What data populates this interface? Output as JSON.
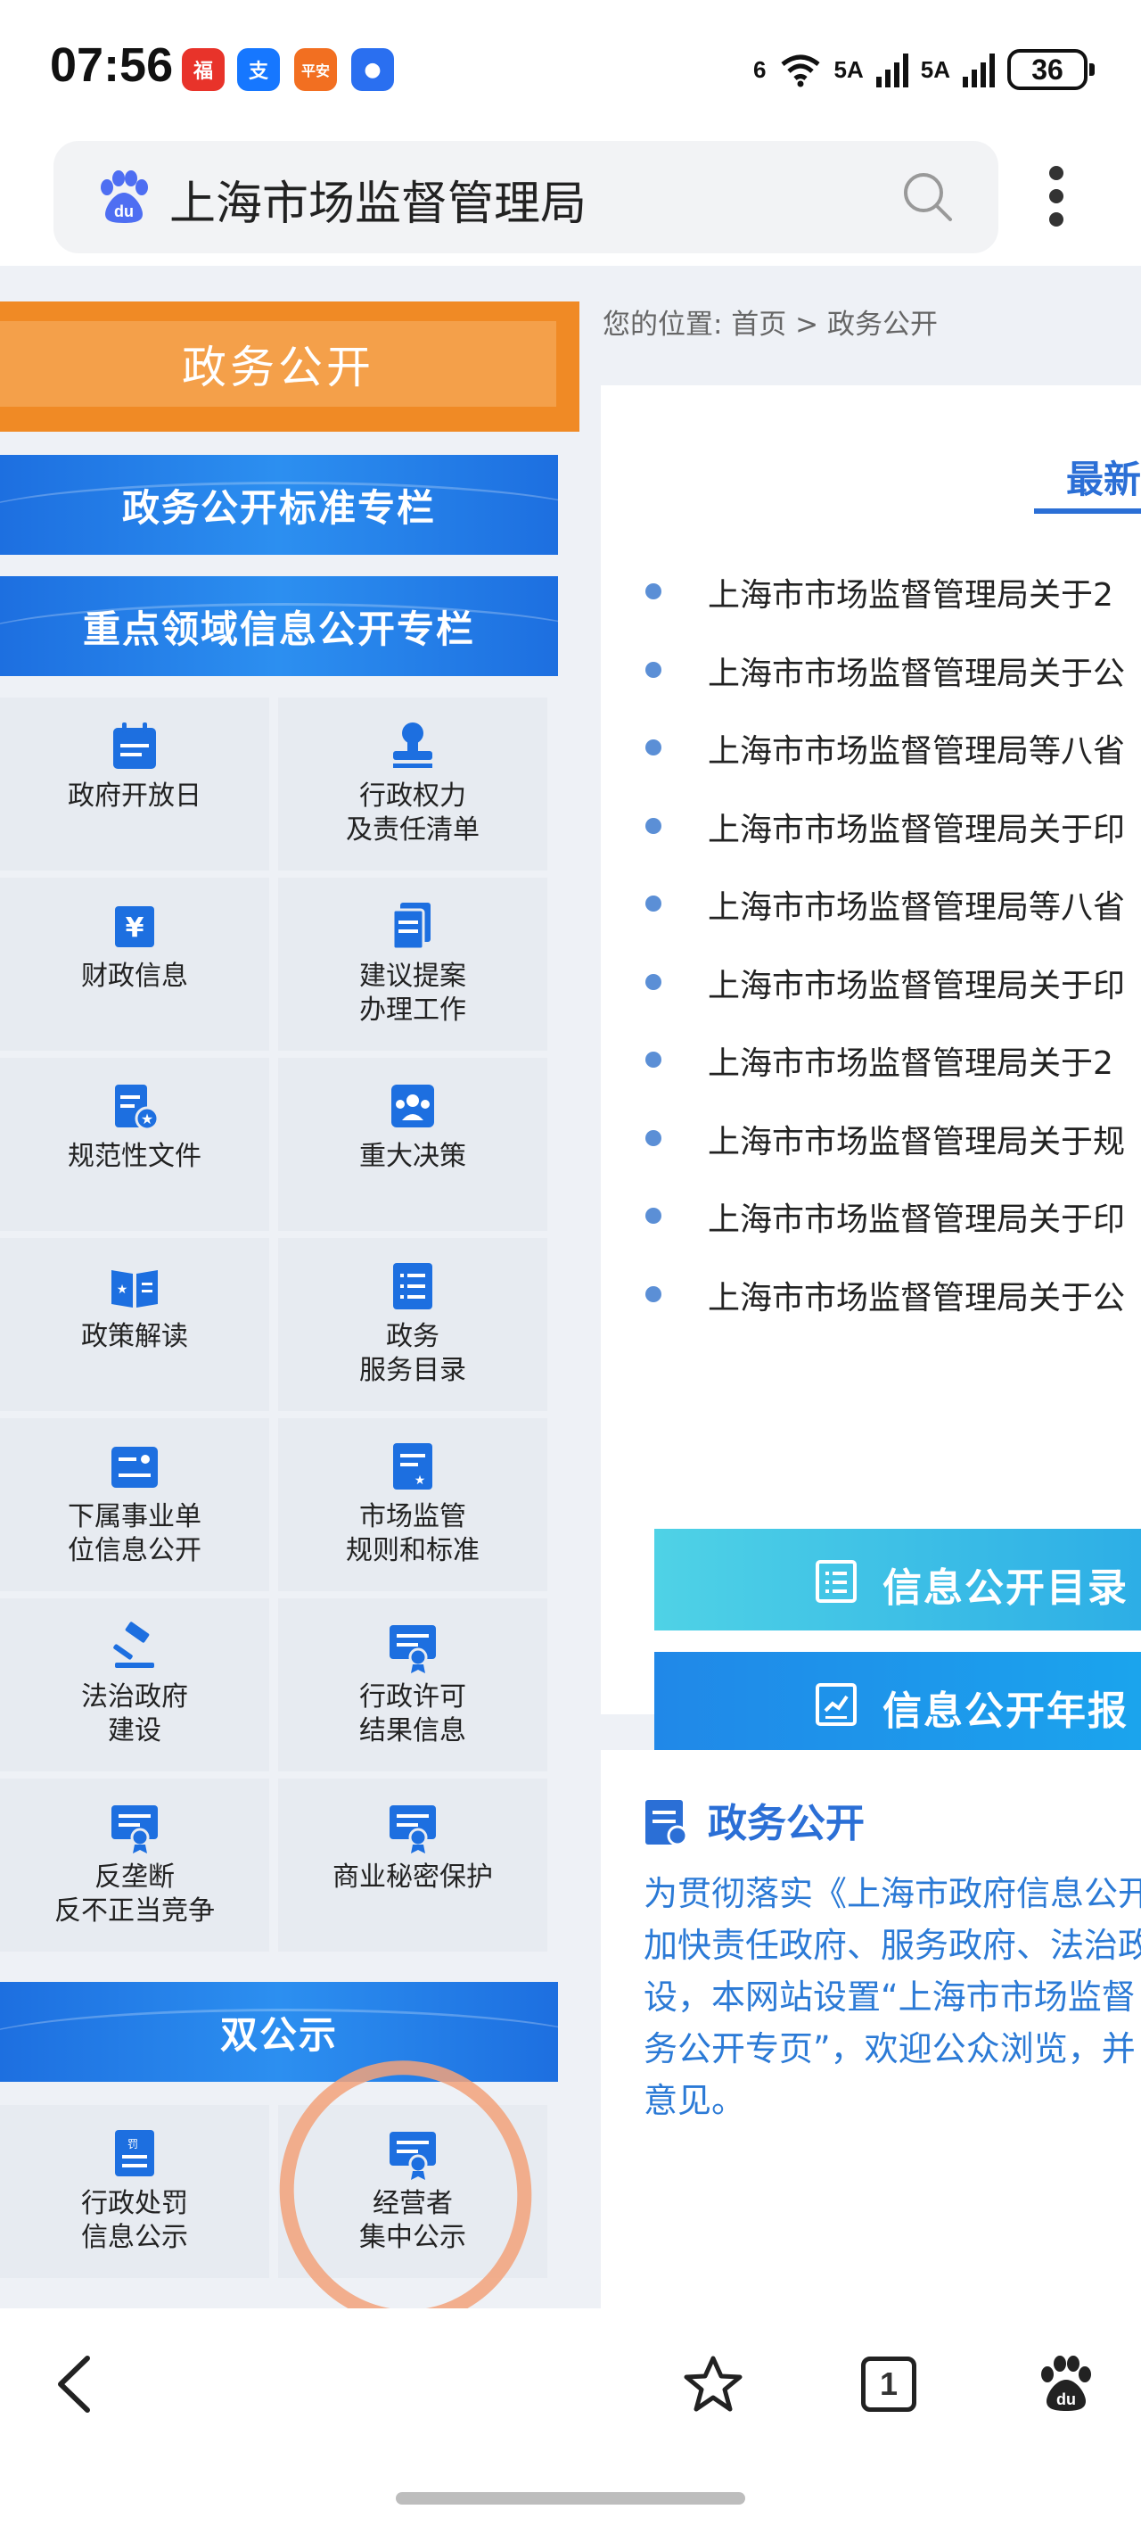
{
  "status_bar": {
    "time": "07:56",
    "app_icons": [
      {
        "name": "app-icon-red",
        "color": "#e8332a",
        "glyph": "福"
      },
      {
        "name": "alipay-icon",
        "color": "#1677ff",
        "glyph": "支"
      },
      {
        "name": "pingan-bank-icon",
        "color": "#f26f21",
        "glyph": "平安"
      },
      {
        "name": "shield-app-icon",
        "color": "#2a6ff0",
        "glyph": "●"
      }
    ],
    "wifi_label": "6",
    "signal1_label": "5A",
    "signal2_label": "5A",
    "battery": "36"
  },
  "search_bar": {
    "title": "上海市场监督管理局"
  },
  "left_nav": {
    "header": "政务公开",
    "banners": [
      "政务公开标准专栏",
      "重点领域信息公开专栏"
    ],
    "items": [
      {
        "label_line1": "政府开放日",
        "label_line2": "",
        "icon": "calendar-icon"
      },
      {
        "label_line1": "行政权力",
        "label_line2": "及责任清单",
        "icon": "stamp-icon"
      },
      {
        "label_line1": "财政信息",
        "label_line2": "",
        "icon": "yuan-icon"
      },
      {
        "label_line1": "建议提案",
        "label_line2": "办理工作",
        "icon": "document-stack-icon"
      },
      {
        "label_line1": "规范性文件",
        "label_line2": "",
        "icon": "document-star-icon"
      },
      {
        "label_line1": "重大决策",
        "label_line2": "",
        "icon": "gear-people-icon"
      },
      {
        "label_line1": "政策解读",
        "label_line2": "",
        "icon": "open-book-icon"
      },
      {
        "label_line1": "政务",
        "label_line2": "服务目录",
        "icon": "list-icon"
      },
      {
        "label_line1": "下属事业单",
        "label_line2": "位信息公开",
        "icon": "id-card-icon"
      },
      {
        "label_line1": "市场监管",
        "label_line2": "规则和标准",
        "icon": "rules-icon"
      },
      {
        "label_line1": "法治政府",
        "label_line2": "建设",
        "icon": "gavel-icon"
      },
      {
        "label_line1": "行政许可",
        "label_line2": "结果信息",
        "icon": "certificate-icon"
      },
      {
        "label_line1": "反垄断",
        "label_line2": "反不正当竞争",
        "icon": "certificate-icon"
      },
      {
        "label_line1": "商业秘密保护",
        "label_line2": "",
        "icon": "certificate-icon"
      }
    ],
    "double_banner": "双公示",
    "double_items": [
      {
        "label_line1": "行政处罚",
        "label_line2": "信息公示",
        "icon": "penalty-icon"
      },
      {
        "label_line1": "经营者",
        "label_line2": "集中公示",
        "icon": "certificate-icon"
      }
    ]
  },
  "breadcrumb": "您的位置: 首页 > 政务公开",
  "latest": {
    "tab_label": "最新",
    "news": [
      "上海市市场监督管理局关于2",
      "上海市市场监督管理局关于公",
      "上海市市场监督管理局等八省",
      "上海市市场监督管理局关于印",
      "上海市市场监督管理局等八省",
      "上海市市场监督管理局关于印",
      "上海市市场监督管理局关于2",
      "上海市市场监督管理局关于规",
      "上海市市场监督管理局关于印",
      "上海市市场监督管理局关于公"
    ]
  },
  "buttons": {
    "directory": "信息公开目录",
    "annual_report": "信息公开年报"
  },
  "intro": {
    "title": "政务公开",
    "lines": [
      "为贯彻落实《上海市政府信息公开",
      "加快责任政府、服务政府、法治政",
      "设，本网站设置“上海市市场监督",
      "务公开专页”，欢迎公众浏览，并",
      "意见。"
    ]
  },
  "bottom_nav": {
    "tab_count": "1"
  },
  "colors": {
    "accent_blue": "#2b6fd6",
    "header_orange": "#f08a25",
    "annotation_circle": "#f2a27a"
  }
}
